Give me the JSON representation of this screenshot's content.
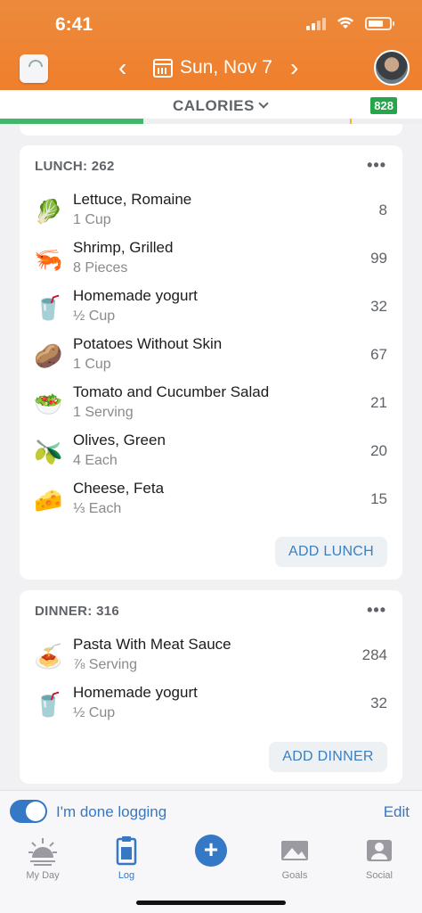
{
  "status": {
    "time": "6:41"
  },
  "header": {
    "date": "Sun, Nov 7",
    "prev_icon": "chevron-left-icon",
    "next_icon": "chevron-right-icon"
  },
  "calories": {
    "label": "CALORIES",
    "remaining": "828",
    "progress_fraction": 0.34
  },
  "lunch": {
    "title": "LUNCH: 262",
    "more": "•••",
    "items": [
      {
        "name": "Lettuce, Romaine",
        "portion": "1 Cup",
        "cals": "8",
        "icon": "🥬"
      },
      {
        "name": "Shrimp, Grilled",
        "portion": "8 Pieces",
        "cals": "99",
        "icon": "🦐"
      },
      {
        "name": "Homemade yogurt",
        "portion": "½ Cup",
        "cals": "32",
        "icon": "🥤"
      },
      {
        "name": "Potatoes Without Skin",
        "portion": "1 Cup",
        "cals": "67",
        "icon": "🥔"
      },
      {
        "name": "Tomato and Cucumber Salad",
        "portion": "1 Serving",
        "cals": "21",
        "icon": "🥗"
      },
      {
        "name": "Olives, Green",
        "portion": "4 Each",
        "cals": "20",
        "icon": "🫒"
      },
      {
        "name": "Cheese, Feta",
        "portion": "⅓ Each",
        "cals": "15",
        "icon": "🧀"
      }
    ],
    "add_label": "ADD LUNCH"
  },
  "dinner": {
    "title": "DINNER: 316",
    "more": "•••",
    "items": [
      {
        "name": "Pasta With Meat Sauce",
        "portion": "⅞ Serving",
        "cals": "284",
        "icon": "🍝"
      },
      {
        "name": "Homemade yogurt",
        "portion": "½ Cup",
        "cals": "32",
        "icon": "🥤"
      }
    ],
    "add_label": "ADD DINNER"
  },
  "done": {
    "label": "I'm done logging",
    "edit": "Edit",
    "toggled": true
  },
  "tabs": [
    {
      "label": "My Day"
    },
    {
      "label": "Log"
    },
    {
      "label": "+"
    },
    {
      "label": "Goals"
    },
    {
      "label": "Social"
    }
  ]
}
